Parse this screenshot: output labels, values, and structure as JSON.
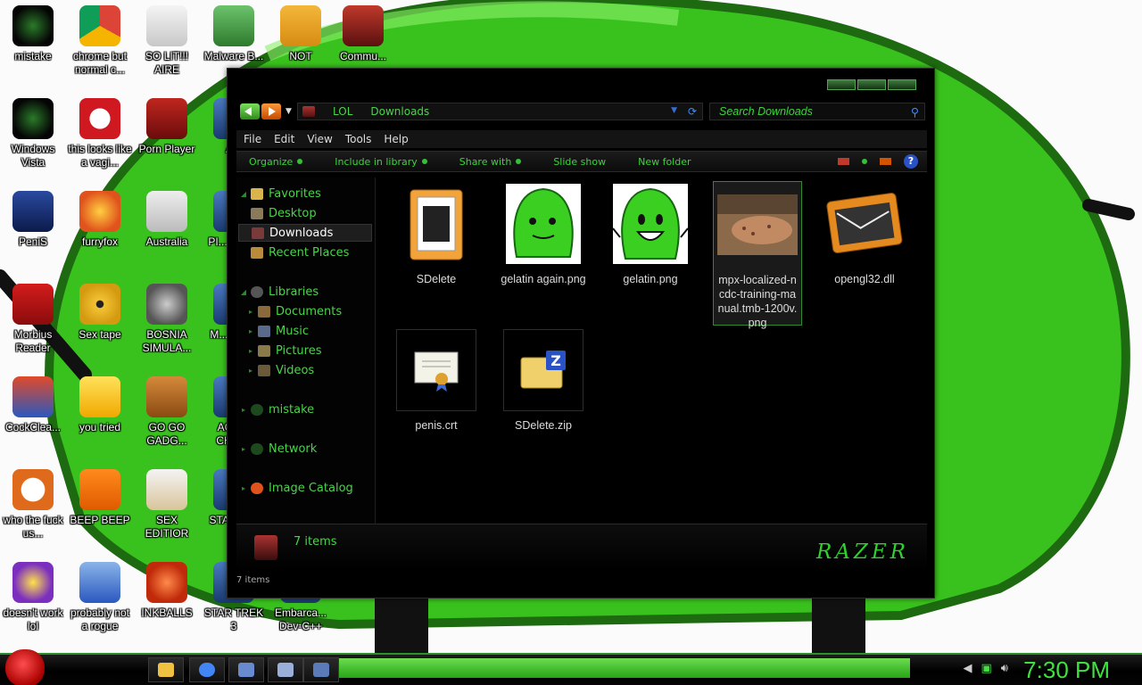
{
  "desktop": {
    "icons": [
      {
        "label": "mistake",
        "icon": "razer-orb-icon"
      },
      {
        "label": "chrome but normal c...",
        "icon": "chrome-icon"
      },
      {
        "label": "SO LIT!!! AIRE",
        "icon": "card-game-icon"
      },
      {
        "label": "Malware B...",
        "icon": "shield-check-icon"
      },
      {
        "label": "NOT",
        "icon": "angry-pig-icon"
      },
      {
        "label": "Commu...",
        "icon": "crest-icon"
      },
      {
        "label": "Windows Vista",
        "icon": "razer-orb-icon"
      },
      {
        "label": "this looks like a vagi...",
        "icon": "opera-icon"
      },
      {
        "label": "Porn Player",
        "icon": "flash-icon"
      },
      {
        "label": "A...",
        "icon": "app-icon"
      },
      {
        "label": "PeniS",
        "icon": "photoshop-icon"
      },
      {
        "label": "furryfox",
        "icon": "firefox-icon"
      },
      {
        "label": "Australia",
        "icon": "spider-icon"
      },
      {
        "label": "PI... OFF...",
        "icon": "app-icon"
      },
      {
        "label": "Morbius Reader",
        "icon": "pdf-icon"
      },
      {
        "label": "Sex tape",
        "icon": "disc-icon"
      },
      {
        "label": "BOSNIA SIMULA...",
        "icon": "spiked-ball-icon"
      },
      {
        "label": "M... BIR...",
        "icon": "app-icon"
      },
      {
        "label": "CockClea...",
        "icon": "ccleaner-icon"
      },
      {
        "label": "you tried",
        "icon": "star-icon"
      },
      {
        "label": "GO GO GADG...",
        "icon": "briefcase-icon"
      },
      {
        "label": "AGG... CHIC...",
        "icon": "app-icon"
      },
      {
        "label": "who the fuck us...",
        "icon": "lightning-icon"
      },
      {
        "label": "BEEP BEEP",
        "icon": "vlc-cone-icon"
      },
      {
        "label": "SEX EDITIOR",
        "icon": "hex-editor-icon"
      },
      {
        "label": "STA... G...",
        "icon": "app-icon"
      },
      {
        "label": "doesn't work lol",
        "icon": "yahoo-icon"
      },
      {
        "label": "probably not a rogue",
        "icon": "settings-monitor-icon"
      },
      {
        "label": "INKBALLS",
        "icon": "inkball-icon"
      },
      {
        "label": "STAR TREK 3",
        "icon": "app-icon"
      },
      {
        "label": "Embarca... Dev-C++",
        "icon": "app-icon"
      }
    ]
  },
  "explorer": {
    "breadcrumb": [
      "LOL",
      "Downloads"
    ],
    "search_placeholder": "Search Downloads",
    "menu": [
      "File",
      "Edit",
      "View",
      "Tools",
      "Help"
    ],
    "commands": [
      "Organize",
      "Include in library",
      "Share with",
      "Slide show",
      "New folder"
    ],
    "help_label": "?",
    "nav": {
      "favorites": "Favorites",
      "desktop": "Desktop",
      "downloads": "Downloads",
      "recent_places": "Recent Places",
      "libraries": "Libraries",
      "documents": "Documents",
      "music": "Music",
      "pictures": "Pictures",
      "videos": "Videos",
      "mistake": "mistake",
      "network": "Network",
      "image_catalog": "Image Catalog"
    },
    "files": [
      {
        "name": "SDelete",
        "icon": "folder-icon"
      },
      {
        "name": "gelatin again.png",
        "icon": "gelatin-image-icon"
      },
      {
        "name": "gelatin.png",
        "icon": "gelatin-image-icon"
      },
      {
        "name": "mpx-localized-ncdc-training-manual.tmb-1200v.png",
        "icon": "photo-thumbnail-icon"
      },
      {
        "name": "opengl32.dll",
        "icon": "dll-icon"
      },
      {
        "name": "penis.crt",
        "icon": "certificate-icon"
      },
      {
        "name": "SDelete.zip",
        "icon": "zip-icon"
      }
    ],
    "details_count": "7 items",
    "status_text": "7 items",
    "brand": "RAZER"
  },
  "taskbar": {
    "clock": "7:30 PM"
  },
  "colors": {
    "accent_green": "#3cd43c",
    "window_bg": "#000000",
    "wallpaper_green": "#39c21d"
  }
}
